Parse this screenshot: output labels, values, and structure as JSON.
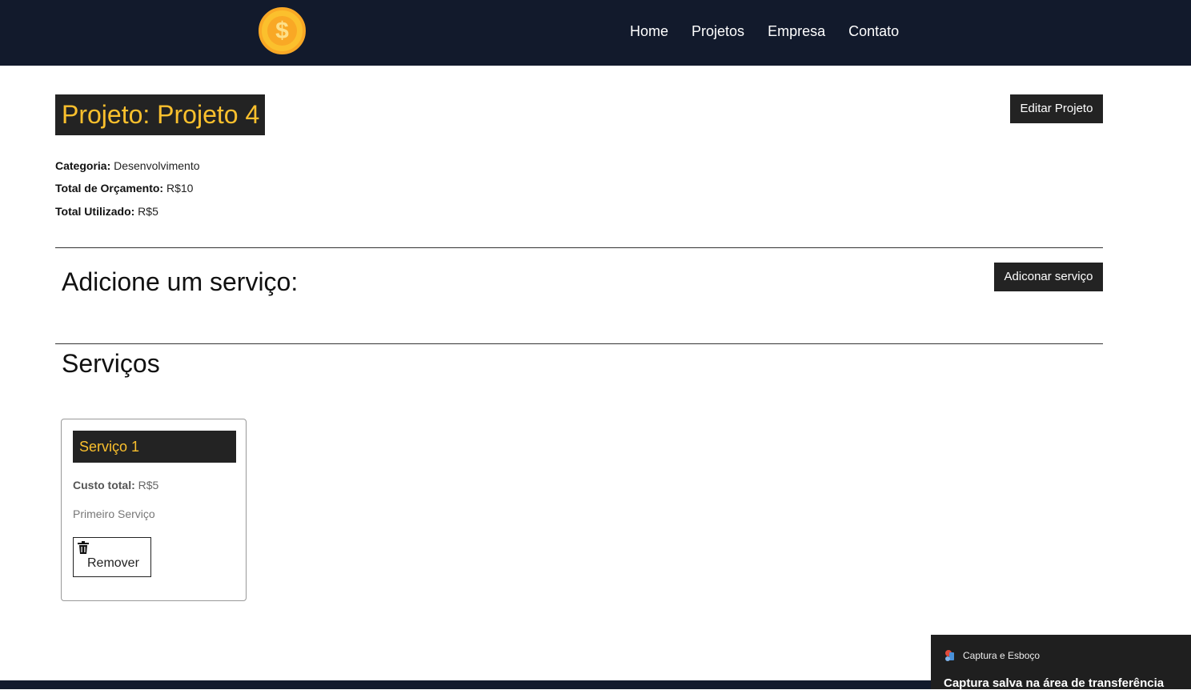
{
  "navbar": {
    "logo_symbol": "$",
    "links": [
      {
        "label": "Home"
      },
      {
        "label": "Projetos"
      },
      {
        "label": "Empresa"
      },
      {
        "label": "Contato"
      }
    ]
  },
  "project": {
    "title": "Projeto: Projeto 4",
    "edit_button_label": "Editar Projeto",
    "category_label": "Categoria:",
    "category_value": " Desenvolvimento",
    "budget_label": "Total de Orçamento:",
    "budget_value": " R$10",
    "used_label": "Total Utilizado:",
    "used_value": " R$5"
  },
  "add_service": {
    "heading": "Adicione um serviço:",
    "button_label": "Adiconar serviço"
  },
  "services": {
    "heading": "Serviços",
    "items": [
      {
        "title": "Serviço 1",
        "cost_label": "Custo total:",
        "cost_value": " R$5",
        "description": "Primeiro Serviço",
        "remove_label": "Remover"
      }
    ]
  },
  "toast": {
    "app_name": "Captura e Esboço",
    "message": "Captura salva na área de transferência"
  },
  "colors": {
    "navbar_bg": "#121a2c",
    "accent_yellow": "#fbc02d",
    "dark_block": "#232323"
  }
}
